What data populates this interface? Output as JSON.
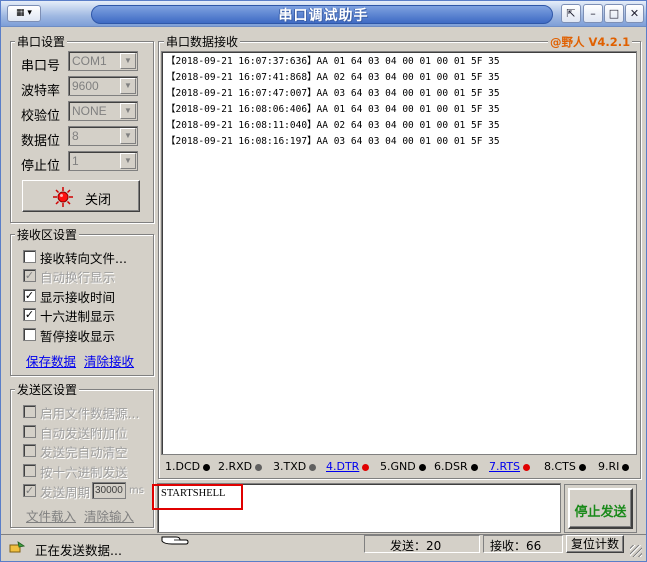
{
  "window": {
    "title": "串口调试助手"
  },
  "serial_settings": {
    "legend": "串口设置",
    "fields": [
      {
        "label": "串口号",
        "value": "COM1"
      },
      {
        "label": "波特率",
        "value": "9600"
      },
      {
        "label": "校验位",
        "value": "NONE"
      },
      {
        "label": "数据位",
        "value": "8"
      },
      {
        "label": "停止位",
        "value": "1"
      }
    ],
    "close_button": "关闭"
  },
  "receive_settings": {
    "legend": "接收区设置",
    "options": [
      {
        "label": "接收转向文件...",
        "checked": false,
        "enabled": true
      },
      {
        "label": "自动换行显示",
        "checked": true,
        "enabled": false
      },
      {
        "label": "显示接收时间",
        "checked": true,
        "enabled": true
      },
      {
        "label": "十六进制显示",
        "checked": true,
        "enabled": true
      },
      {
        "label": "暂停接收显示",
        "checked": false,
        "enabled": true
      }
    ],
    "save_link": "保存数据",
    "clear_link": "清除接收"
  },
  "send_settings": {
    "legend": "发送区设置",
    "options": [
      {
        "label": "启用文件数据源...",
        "checked": false
      },
      {
        "label": "自动发送附加位",
        "checked": false
      },
      {
        "label": "发送完自动清空",
        "checked": false
      },
      {
        "label": "按十六进制发送",
        "checked": false
      }
    ],
    "period_label": "发送周期",
    "period_value": "30000",
    "period_unit": "ms",
    "load_link": "文件载入",
    "clear_link": "清除输入"
  },
  "receive_panel": {
    "legend": "串口数据接收",
    "brand": "@野人 V4.2.1",
    "lines": [
      "【2018-09-21 16:07:37:636】AA 01 64 03 04 00 01 00 01 5F 35",
      "【2018-09-21 16:07:41:868】AA 02 64 03 04 00 01 00 01 5F 35",
      "【2018-09-21 16:07:47:007】AA 03 64 03 04 00 01 00 01 5F 35",
      "【2018-09-21 16:08:06:406】AA 01 64 03 04 00 01 00 01 5F 35",
      "【2018-09-21 16:08:11:040】AA 02 64 03 04 00 01 00 01 5F 35",
      "【2018-09-21 16:08:16:197】AA 03 64 03 04 00 01 00 01 5F 35"
    ]
  },
  "signals": [
    {
      "label": "1.DCD",
      "color": "#000000",
      "link": false
    },
    {
      "label": "2.RXD",
      "color": "#606060",
      "link": false
    },
    {
      "label": "3.TXD",
      "color": "#606060",
      "link": false
    },
    {
      "label": "4.DTR",
      "color": "#e00000",
      "link": true
    },
    {
      "label": "5.GND",
      "color": "#000000",
      "link": false
    },
    {
      "label": "6.DSR",
      "color": "#000000",
      "link": false
    },
    {
      "label": "7.RTS",
      "color": "#e00000",
      "link": true
    },
    {
      "label": "8.CTS",
      "color": "#000000",
      "link": false
    },
    {
      "label": "9.RI",
      "color": "#000000",
      "link": false
    }
  ],
  "send_input": {
    "value": "STARTSHELL"
  },
  "stop_send_button": "停止发送",
  "status": {
    "message": "正在发送数据...",
    "sent": "发送：20",
    "received": "接收：66",
    "reset_button": "复位计数"
  },
  "colors": {
    "brand": "#e06000",
    "highlight": "#e00000",
    "stop_text": "#1a8a1a"
  }
}
